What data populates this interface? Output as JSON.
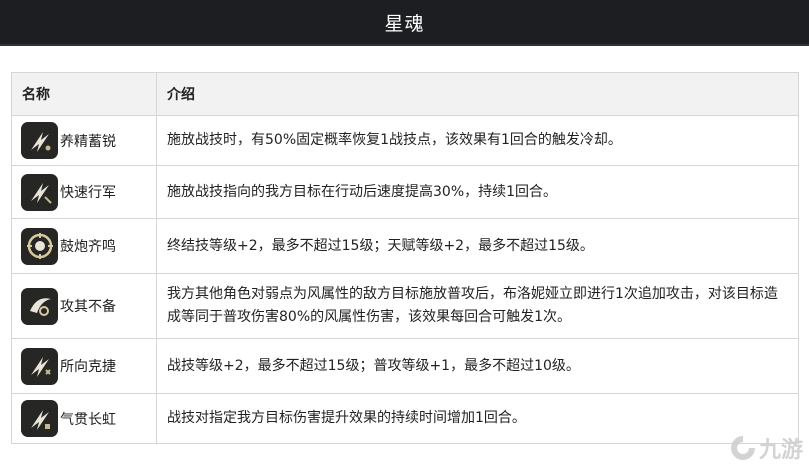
{
  "header": {
    "title": "星魂"
  },
  "table": {
    "columns": [
      "名称",
      "介绍"
    ],
    "rows": [
      {
        "name": "养精蓄锐",
        "icon": "eidolon-slash-icon",
        "desc": "施放战技时，有50%固定概率恢复1战技点，该效果有1回合的触发冷却。"
      },
      {
        "name": "快速行军",
        "icon": "eidolon-slash-icon",
        "desc": "施放战技指向的我方目标在行动后速度提高30%，持续1回合。"
      },
      {
        "name": "鼓炮齐鸣",
        "icon": "eidolon-drum-icon",
        "desc": "终结技等级+2，最多不超过15级；天赋等级+2，最多不超过15级。"
      },
      {
        "name": "攻其不备",
        "icon": "eidolon-strike-icon",
        "desc": "我方其他角色对弱点为风属性的敌方目标施放普攻后，布洛妮娅立即进行1次追加攻击，对该目标造成等同于普攻伤害80%的风属性伤害，该效果每回合可触发1次。"
      },
      {
        "name": "所向克捷",
        "icon": "eidolon-slash-icon",
        "desc": "战技等级+2，最多不超过15级；普攻等级+1，最多不超过10级。"
      },
      {
        "name": "气贯长虹",
        "icon": "eidolon-slash-icon",
        "desc": "战技对指定我方目标伤害提升效果的持续时间增加1回合。"
      }
    ]
  },
  "watermark": {
    "text": "九游",
    "icon": "jiuyou-logo-icon"
  },
  "colors": {
    "header_bg": "#1c1e22",
    "table_header_bg": "#f2f2f2",
    "border": "#d6d6d6",
    "icon_bg": "#262624"
  }
}
